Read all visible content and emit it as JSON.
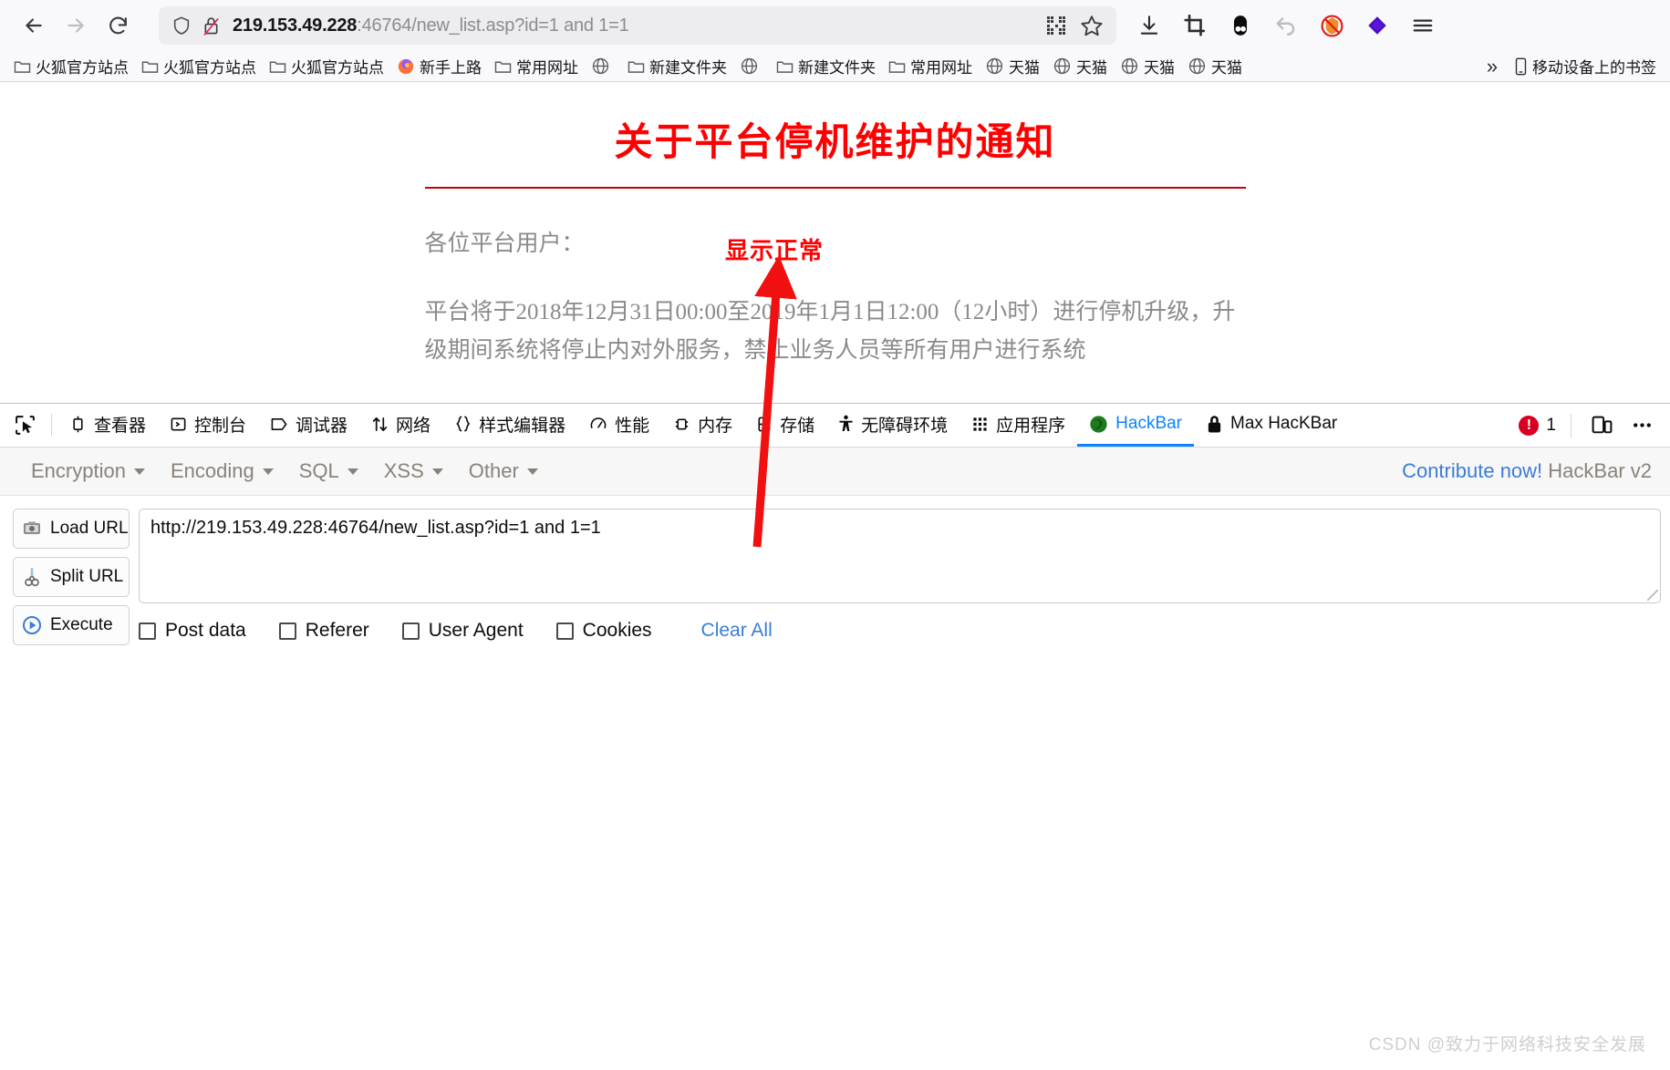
{
  "browser": {
    "nav": {
      "back": "back-arrow",
      "forward": "forward-arrow",
      "reload": "reload"
    },
    "urlbar": {
      "host": "219.153.49.228",
      "rest": ":46764/new_list.asp?id=1 and 1=1",
      "full": "219.153.49.228:46764/new_list.asp?id=1 and 1=1",
      "shield_icon": "tracking-shield-icon",
      "lock_icon": "broken-lock-icon",
      "qr_icon": "qr-code-icon",
      "bookmark_icon": "star-icon"
    },
    "toolbar_right": [
      {
        "name": "downloads-icon",
        "glyph": "download"
      },
      {
        "name": "screenshot-icon",
        "glyph": "crop"
      },
      {
        "name": "containers-icon",
        "glyph": "pill"
      },
      {
        "name": "undo-close-tab-icon",
        "glyph": "undo"
      },
      {
        "name": "noscript-icon",
        "glyph": "noscript"
      },
      {
        "name": "violentmonkey-icon",
        "glyph": "diamond"
      },
      {
        "name": "app-menu-icon",
        "glyph": "hamburger"
      }
    ]
  },
  "bookmarks": {
    "items": [
      {
        "label": "火狐官方站点",
        "icon": "folder-icon"
      },
      {
        "label": "火狐官方站点",
        "icon": "folder-icon"
      },
      {
        "label": "火狐官方站点",
        "icon": "folder-icon"
      },
      {
        "label": "新手上路",
        "icon": "firefox-icon"
      },
      {
        "label": "常用网址",
        "icon": "folder-icon"
      },
      {
        "label": "",
        "icon": "globe-icon"
      },
      {
        "label": "新建文件夹",
        "icon": "folder-icon"
      },
      {
        "label": "",
        "icon": "globe-icon"
      },
      {
        "label": "新建文件夹",
        "icon": "folder-icon"
      },
      {
        "label": "常用网址",
        "icon": "folder-icon"
      },
      {
        "label": "天猫",
        "icon": "globe-icon"
      },
      {
        "label": "天猫",
        "icon": "globe-icon"
      },
      {
        "label": "天猫",
        "icon": "globe-icon"
      },
      {
        "label": "天猫",
        "icon": "globe-icon"
      }
    ],
    "overflow": "»",
    "mobile": {
      "label": "移动设备上的书签",
      "icon": "mobile-icon"
    }
  },
  "page": {
    "title": "关于平台停机维护的通知",
    "greeting": "各位平台用户：",
    "paragraph": "平台将于2018年12月31日00:00至2019年1月1日12:00（12小时）进行停机升级，升级期间系统将停止内对外服务，禁止业务人员等所有用户进行系统",
    "annotation": "显示正常",
    "annotation_color": "#ff0000",
    "title_color": "#ff0000"
  },
  "devtools": {
    "picker_icon": "element-picker-icon",
    "tabs": [
      {
        "label": "查看器",
        "icon": "inspector-icon",
        "active": false
      },
      {
        "label": "控制台",
        "icon": "console-icon",
        "active": false
      },
      {
        "label": "调试器",
        "icon": "debugger-icon",
        "active": false
      },
      {
        "label": "网络",
        "icon": "network-icon",
        "active": false
      },
      {
        "label": "样式编辑器",
        "icon": "style-editor-icon",
        "active": false
      },
      {
        "label": "性能",
        "icon": "performance-icon",
        "active": false
      },
      {
        "label": "内存",
        "icon": "memory-icon",
        "active": false
      },
      {
        "label": "存储",
        "icon": "storage-icon",
        "active": false
      },
      {
        "label": "无障碍环境",
        "icon": "accessibility-icon",
        "active": false
      },
      {
        "label": "应用程序",
        "icon": "application-icon",
        "active": false
      },
      {
        "label": "HackBar",
        "icon": "hackbar-icon",
        "active": true
      },
      {
        "label": "Max HacKBar",
        "icon": "lock-icon",
        "active": false
      }
    ],
    "error_count": "1",
    "responsive_icon": "responsive-design-mode-icon",
    "meatball_icon": "more-options-icon",
    "active_accent": "#0a84ff",
    "error_color": "#d70022"
  },
  "hackbar": {
    "menus": [
      {
        "label": "Encryption"
      },
      {
        "label": "Encoding"
      },
      {
        "label": "SQL"
      },
      {
        "label": "XSS"
      },
      {
        "label": "Other"
      }
    ],
    "credit_link": "Contribute now!",
    "credit_text": " HackBar v2",
    "buttons": [
      {
        "label": "Load URL",
        "icon": "load-url-icon"
      },
      {
        "label": "Split URL",
        "icon": "split-url-icon"
      },
      {
        "label": "Execute",
        "icon": "execute-icon"
      }
    ],
    "url_value": "http://219.153.49.228:46764/new_list.asp?id=1 and 1=1",
    "url_placeholder": "",
    "checkboxes": [
      {
        "label": "Post data",
        "checked": false
      },
      {
        "label": "Referer",
        "checked": false
      },
      {
        "label": "User Agent",
        "checked": false
      },
      {
        "label": "Cookies",
        "checked": false
      }
    ],
    "clear_all": "Clear All",
    "link_color": "#3b7dd8"
  },
  "footer": {
    "watermark": "CSDN @致力于网络科技安全发展"
  }
}
